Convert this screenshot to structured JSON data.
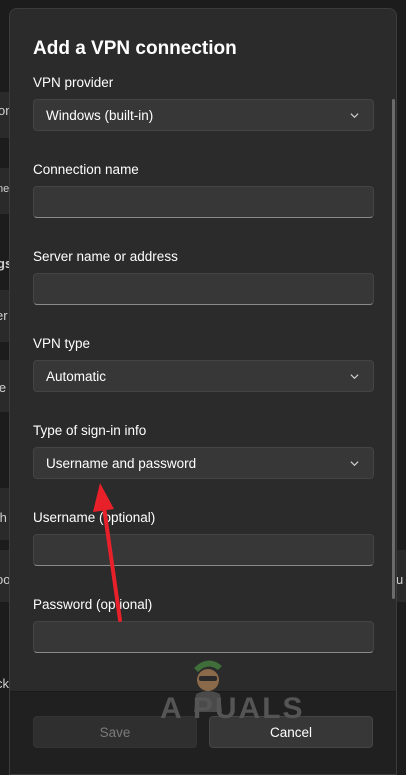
{
  "dialog": {
    "title": "Add a VPN connection",
    "fields": {
      "vpn_provider": {
        "label": "VPN provider",
        "value": "Windows (built-in)"
      },
      "connection_name": {
        "label": "Connection name",
        "value": ""
      },
      "server_name": {
        "label": "Server name or address",
        "value": ""
      },
      "vpn_type": {
        "label": "VPN type",
        "value": "Automatic"
      },
      "sign_in_type": {
        "label": "Type of sign-in info",
        "value": "Username and password"
      },
      "username": {
        "label": "Username (optional)",
        "value": ""
      },
      "password": {
        "label": "Password (optional)",
        "value": ""
      }
    },
    "buttons": {
      "save": "Save",
      "cancel": "Cancel"
    }
  },
  "background_fragments": [
    "on",
    "ne",
    "gs",
    "er",
    "le",
    "th",
    "oo",
    "ck",
    "u"
  ],
  "watermark": {
    "text": "A PUALS"
  },
  "colors": {
    "dialog_bg": "#2b2b2b",
    "control_bg": "#373737",
    "annotation_arrow": "#e8202a"
  }
}
